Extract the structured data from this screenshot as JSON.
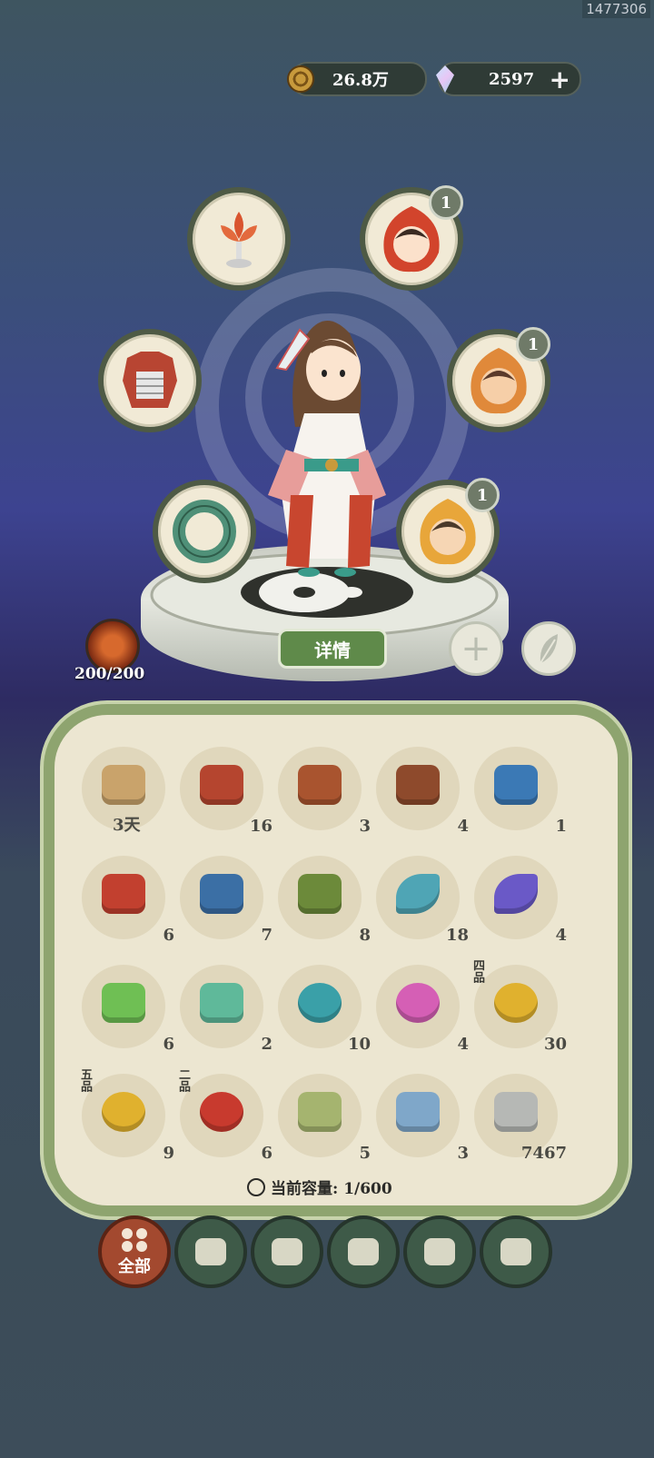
{
  "user_id": "1477306",
  "currency": {
    "coins": "26.8万",
    "jade": "2597",
    "add": "+"
  },
  "equipment": [
    {
      "name": "lotus-lamp-icon",
      "badge": ""
    },
    {
      "name": "portrait-red-icon",
      "badge": "1"
    },
    {
      "name": "armor-icon",
      "badge": ""
    },
    {
      "name": "portrait-orange-icon",
      "badge": "1"
    },
    {
      "name": "jade-bracelet-icon",
      "badge": ""
    },
    {
      "name": "portrait-gold-icon",
      "badge": "1"
    }
  ],
  "detail_button": "详情",
  "stamina": "200/200",
  "items": [
    {
      "icon": "scroll-icon",
      "count": "3天",
      "color": "#c9a36b"
    },
    {
      "icon": "chest-red-icon",
      "count": "16",
      "color": "#b5452f"
    },
    {
      "icon": "chest-red-icon",
      "count": "3",
      "color": "#a9542f"
    },
    {
      "icon": "chest-red-icon",
      "count": "4",
      "color": "#8e4a2c"
    },
    {
      "icon": "chest-blue-icon",
      "count": "1",
      "color": "#3b79b5"
    },
    {
      "icon": "box-red-icon",
      "count": "6",
      "color": "#c2402f"
    },
    {
      "icon": "box-blue-icon",
      "count": "7",
      "color": "#3b6fa5"
    },
    {
      "icon": "box-green-icon",
      "count": "8",
      "color": "#6c8a3a"
    },
    {
      "icon": "fish-teal-icon",
      "count": "18",
      "color": "#4fa5b5"
    },
    {
      "icon": "fish-purple-icon",
      "count": "4",
      "color": "#6a59c7"
    },
    {
      "icon": "potion-green-icon",
      "count": "6",
      "color": "#6fbf54"
    },
    {
      "icon": "potion-teal-icon",
      "count": "2",
      "color": "#5fb99a"
    },
    {
      "icon": "spirit-teal-icon",
      "count": "10",
      "color": "#3aa0a8"
    },
    {
      "icon": "spirit-pink-icon",
      "count": "4",
      "color": "#d55fb5"
    },
    {
      "icon": "fruit-gold-icon",
      "count": "30",
      "color": "#e0b12e",
      "grade": "四品"
    },
    {
      "icon": "fruit-gold-icon",
      "count": "9",
      "color": "#e0b12e",
      "grade": "五品"
    },
    {
      "icon": "berry-red-icon",
      "count": "6",
      "color": "#c83a2e",
      "grade": "二品"
    },
    {
      "icon": "pouch-green-icon",
      "count": "5",
      "color": "#a5b46f"
    },
    {
      "icon": "pouch-blue-icon",
      "count": "3",
      "color": "#7fa7c9"
    },
    {
      "icon": "stone-icon",
      "count": "7467",
      "color": "#b6b8b5"
    }
  ],
  "capacity": "当前容量: 1/600",
  "tabs": [
    {
      "name": "tab-all",
      "label": "全部",
      "active": true
    },
    {
      "name": "tab-wood",
      "label": "",
      "active": false
    },
    {
      "name": "tab-herb",
      "label": "",
      "active": false
    },
    {
      "name": "tab-food",
      "label": "",
      "active": false
    },
    {
      "name": "tab-ore",
      "label": "",
      "active": false
    },
    {
      "name": "tab-scroll",
      "label": "",
      "active": false
    }
  ]
}
